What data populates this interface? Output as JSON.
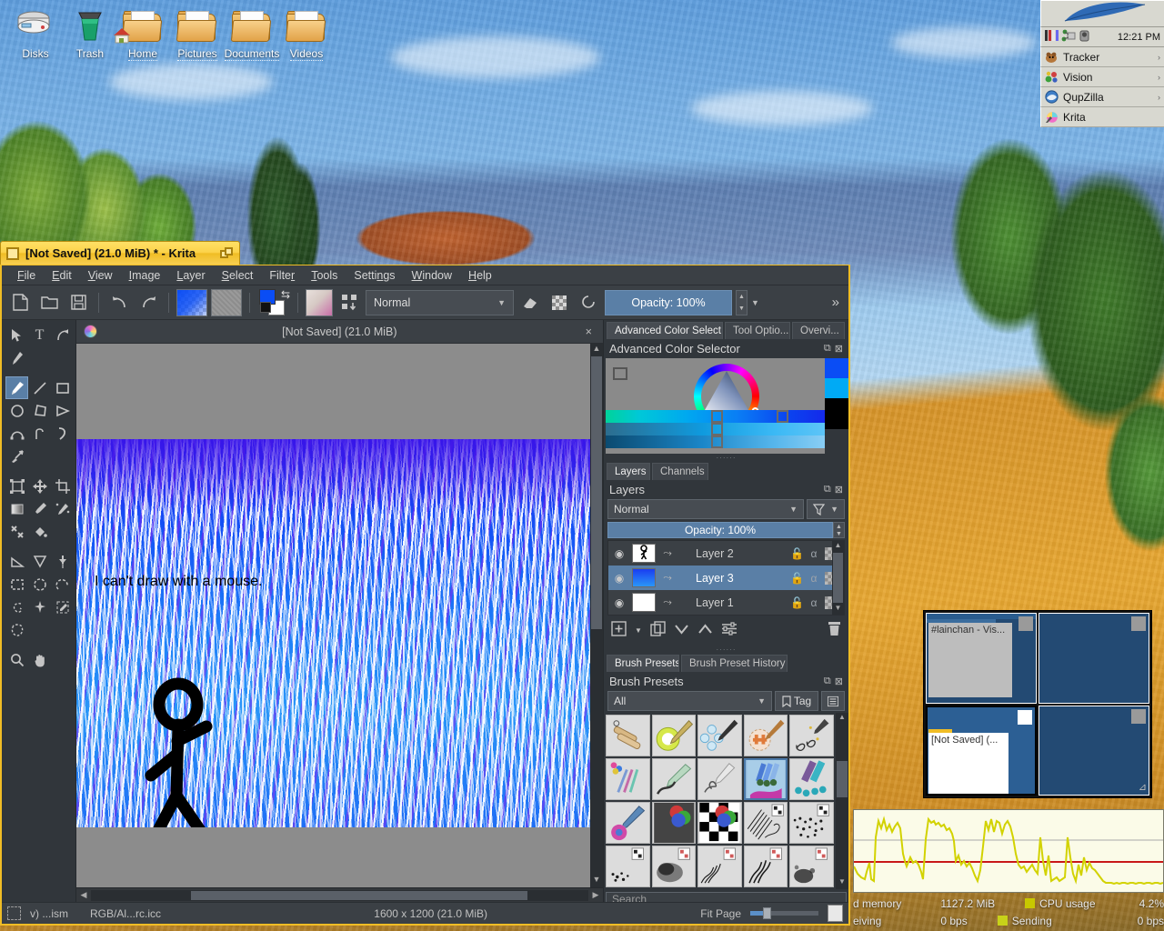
{
  "desktop": {
    "icons": [
      {
        "label": "Disks",
        "icon": "disk-icon"
      },
      {
        "label": "Trash",
        "icon": "trash-icon"
      },
      {
        "label": "Home",
        "icon": "home-folder-icon"
      },
      {
        "label": "Pictures",
        "icon": "folder-icon"
      },
      {
        "label": "Documents",
        "icon": "folder-icon"
      },
      {
        "label": "Videos",
        "icon": "folder-icon"
      }
    ]
  },
  "deskbar": {
    "clock": "12:21 PM",
    "tray_icons": [
      "process-controller-icon",
      "network-icon",
      "volume-icon"
    ],
    "items": [
      {
        "label": "Tracker",
        "icon": "tracker-icon",
        "arrow": "›"
      },
      {
        "label": "Vision",
        "icon": "vision-icon",
        "arrow": "›"
      },
      {
        "label": "QupZilla",
        "icon": "qupzilla-icon",
        "arrow": "›"
      },
      {
        "label": "Krita",
        "icon": "krita-icon",
        "arrow": ""
      }
    ]
  },
  "pager": {
    "workspaces": [
      {
        "active": false,
        "window_title": "#lainchan - Vis..."
      },
      {
        "active": false,
        "window_title": ""
      },
      {
        "active": true,
        "window_title": "[Not Saved]  (..."
      },
      {
        "active": false,
        "window_title": ""
      }
    ]
  },
  "activity_monitor": {
    "rows": [
      {
        "left_label": "d memory",
        "left_value": "1127.2 MiB",
        "right_label": "CPU usage",
        "right_value": "4.2%",
        "swatch": "#c8c800"
      },
      {
        "left_label": "eiving",
        "left_value": "0 bps",
        "right_label": "Sending",
        "right_value": "0 bps",
        "swatch": "#c8d219"
      }
    ]
  },
  "window": {
    "title": "[Not Saved]  (21.0 MiB) * - Krita",
    "close_icon": "close-box-icon",
    "zoom_icon": "zoom-box-icon"
  },
  "menubar": [
    {
      "label": "File",
      "mnemonic": "F"
    },
    {
      "label": "Edit",
      "mnemonic": "E"
    },
    {
      "label": "View",
      "mnemonic": "V"
    },
    {
      "label": "Image",
      "mnemonic": "I"
    },
    {
      "label": "Layer",
      "mnemonic": "L"
    },
    {
      "label": "Select",
      "mnemonic": "S"
    },
    {
      "label": "Filter",
      "mnemonic": "r"
    },
    {
      "label": "Tools",
      "mnemonic": "T"
    },
    {
      "label": "Settings",
      "mnemonic": "n"
    },
    {
      "label": "Window",
      "mnemonic": "W"
    },
    {
      "label": "Help",
      "mnemonic": "H"
    }
  ],
  "toolbar": {
    "new_label": "new-document",
    "open_label": "open-document",
    "save_label": "save-document",
    "undo_label": "undo",
    "redo_label": "redo",
    "gradient_label": "gradient-swatch",
    "pattern_label": "pattern-swatch",
    "fg_color": "#0a4df5",
    "bg_color": "#ffffff",
    "blend_mode": "Normal",
    "opacity_label": "Opacity:  100%",
    "overflow_label": "»"
  },
  "tools": {
    "selected": "freehand-brush-tool",
    "items": [
      "select-shapes-tool",
      "text-tool",
      "edit-shapes-tool",
      "calligraphy-tool",
      "freehand-brush-tool",
      "line-tool",
      "rectangle-tool",
      "ellipse-tool",
      "polygon-tool",
      "polyline-tool",
      "bezier-curve-tool",
      "freehand-path-tool",
      "dynamic-brush-tool",
      "multibrush-tool",
      "transform-tool",
      "move-tool",
      "crop-tool",
      "gradient-tool",
      "color-sampler-tool",
      "colorize-mask-tool",
      "smart-patch-tool",
      "fill-tool",
      "measure-tool",
      "assistant-tool",
      "reference-images-tool",
      "rectangular-selection-tool",
      "elliptical-selection-tool",
      "polygonal-selection-tool",
      "freehand-selection-tool",
      "contiguous-selection-tool",
      "similar-color-selection-tool",
      "bezier-selection-tool",
      "zoom-tool",
      "pan-tool"
    ]
  },
  "canvas": {
    "tab_title": "[Not Saved]  (21.0 MiB)",
    "close_icon": "close-icon",
    "document_icon": "krita-document-icon",
    "text_on_canvas": "I can't draw with a mouse."
  },
  "docks": {
    "top_tabs": [
      {
        "label": "Advanced Color Select...",
        "active": true
      },
      {
        "label": "Tool Optio...",
        "active": false
      },
      {
        "label": "Overvi...",
        "active": false
      }
    ],
    "color_selector": {
      "title": "Advanced Color Selector",
      "float_icon": "float-icon",
      "close_icon": "close-icon",
      "history_swatches": [
        "#0a4df5",
        "#00aaf5",
        "#000000"
      ]
    },
    "layer_tabs": [
      {
        "label": "Layers",
        "active": true
      },
      {
        "label": "Channels",
        "active": false
      }
    ],
    "layers_panel": {
      "title": "Layers",
      "float_icon": "float-icon",
      "close_icon": "close-icon",
      "blend_mode": "Normal",
      "filter_icon": "filter-icon",
      "opacity_label": "Opacity:  100%",
      "rows": [
        {
          "name": "Layer 2",
          "selected": false,
          "visible": true,
          "thumb": "stick-figure"
        },
        {
          "name": "Layer 3",
          "selected": true,
          "visible": true,
          "thumb": "blue-water"
        },
        {
          "name": "Layer 1",
          "selected": false,
          "visible": true,
          "thumb": "white"
        }
      ],
      "buttons": [
        "add-layer-button",
        "duplicate-layer-button",
        "move-layer-down-button",
        "move-layer-up-button",
        "layer-properties-button",
        "delete-layer-button"
      ]
    },
    "brush_tabs": [
      {
        "label": "Brush Presets",
        "active": true
      },
      {
        "label": "Brush Preset History",
        "active": false
      }
    ],
    "brush_panel": {
      "title": "Brush Presets",
      "float_icon": "float-icon",
      "close_icon": "close-icon",
      "filter_value": "All",
      "tag_label": "Tag",
      "list_view_icon": "list-view-icon",
      "search_placeholder": "Search",
      "selected_index": 8
    }
  },
  "statusbar": {
    "selection_icon": "selection-icon",
    "brush_info": "v) ...ism",
    "color_profile": "RGB/Al...rc.icc",
    "dimensions": "1600 x 1200 (21.0 MiB)",
    "zoom_label": "Fit Page"
  }
}
